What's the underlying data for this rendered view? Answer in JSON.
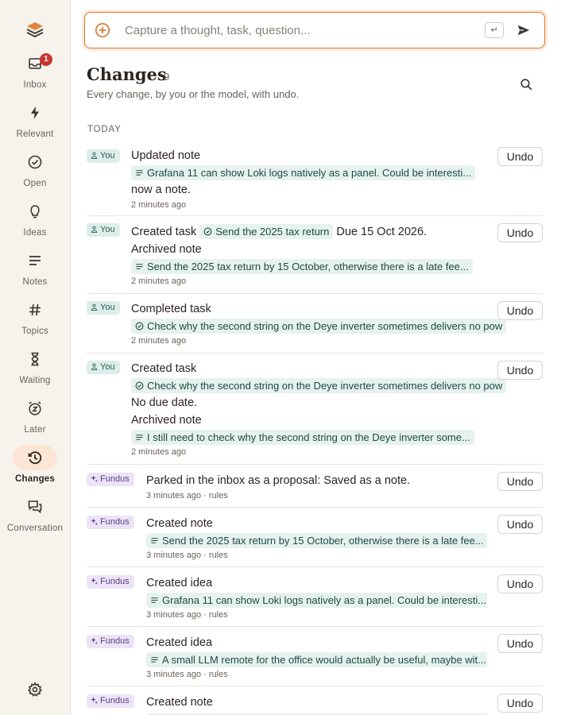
{
  "sidebar": {
    "logo": "stack-logo",
    "items": [
      {
        "id": "inbox",
        "label": "Inbox",
        "icon": "inbox-icon",
        "badge": "1",
        "active": false
      },
      {
        "id": "relevant",
        "label": "Relevant",
        "icon": "bolt-icon",
        "active": false
      },
      {
        "id": "open",
        "label": "Open",
        "icon": "check-circle-icon",
        "active": false
      },
      {
        "id": "ideas",
        "label": "Ideas",
        "icon": "lightbulb-icon",
        "active": false
      },
      {
        "id": "notes",
        "label": "Notes",
        "icon": "lines-icon",
        "active": false
      },
      {
        "id": "topics",
        "label": "Topics",
        "icon": "hash-icon",
        "active": false
      },
      {
        "id": "waiting",
        "label": "Waiting",
        "icon": "hourglass-icon",
        "active": false
      },
      {
        "id": "later",
        "label": "Later",
        "icon": "snooze-clock-icon",
        "active": false
      },
      {
        "id": "changes",
        "label": "Changes",
        "icon": "history-icon",
        "active": true
      },
      {
        "id": "conversation",
        "label": "Conversation",
        "icon": "chat-icon",
        "active": false
      }
    ],
    "settings_icon": "gear-icon"
  },
  "capture": {
    "placeholder": "Capture a thought, task, question...",
    "value": "",
    "enter_hint": "↵"
  },
  "header": {
    "title": "Changes",
    "count": "9",
    "subtitle": "Every change, by you or the model, with undo."
  },
  "section_label": "TODAY",
  "undo_label": "Undo",
  "actors": {
    "you": "You",
    "fundus": "Fundus"
  },
  "entries": {
    "e1": {
      "actor": "You",
      "action": "Updated note",
      "chip": "Grafana 11 can show Loki logs natively as a panel. Could be interesti...",
      "trail": "now a note.",
      "time": "2 minutes ago"
    },
    "e2": {
      "actor": "You",
      "action": "Created task",
      "task_chip": "Send the 2025 tax return",
      "due": "Due 15 Oct 2026.",
      "action2": "Archived note",
      "chip": "Send the 2025 tax return by 15 October, otherwise there is a late fee...",
      "time": "2 minutes ago"
    },
    "e3": {
      "actor": "You",
      "action": "Completed task",
      "chip": "Check why the second string on the Deye inverter sometimes delivers no pow",
      "time": "2 minutes ago"
    },
    "e4": {
      "actor": "You",
      "action": "Created task",
      "chip": "Check why the second string on the Deye inverter sometimes delivers no pow",
      "due": "No due date.",
      "action2": "Archived note",
      "chip2": "I still need to check why the second string on the Deye inverter some...",
      "time": "2 minutes ago"
    },
    "e5": {
      "actor": "Fundus",
      "action": "Parked in the inbox as a proposal: Saved as a note.",
      "time": "3 minutes ago",
      "source": "rules"
    },
    "e6": {
      "actor": "Fundus",
      "action": "Created note",
      "chip": "Send the 2025 tax return by 15 October, otherwise there is a late fee...",
      "time": "3 minutes ago",
      "source": "rules"
    },
    "e7": {
      "actor": "Fundus",
      "action": "Created idea",
      "chip": "Grafana 11 can show Loki logs natively as a panel. Could be interesti...",
      "time": "3 minutes ago",
      "source": "rules"
    },
    "e8": {
      "actor": "Fundus",
      "action": "Created idea",
      "chip": "A small LLM remote for the office would actually be useful, maybe wit...",
      "time": "3 minutes ago",
      "source": "rules"
    },
    "e9": {
      "actor": "Fundus",
      "action": "Created note"
    }
  },
  "meta_separator": "·",
  "colors": {
    "accent": "#d97a32",
    "badge": "#c8362f",
    "you_chip": "#dceee9",
    "fundus_chip": "#ece4f6",
    "item_chip": "#e6f2ee"
  }
}
